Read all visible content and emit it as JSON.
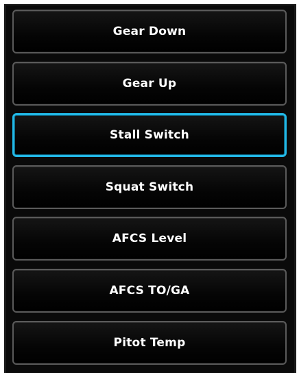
{
  "buttons": [
    {
      "label": "Gear Down",
      "selected": false
    },
    {
      "label": "Gear Up",
      "selected": false
    },
    {
      "label": "Stall Switch",
      "selected": true
    },
    {
      "label": "Squat Switch",
      "selected": false
    },
    {
      "label": "AFCS Level",
      "selected": false
    },
    {
      "label": "AFCS TO/GA",
      "selected": false
    },
    {
      "label": "Pitot Temp",
      "selected": false
    }
  ],
  "colors": {
    "selection_border": "#22b8e6",
    "button_border": "#5a5a5a",
    "background": "#0a0a0a",
    "text": "#ffffff"
  }
}
